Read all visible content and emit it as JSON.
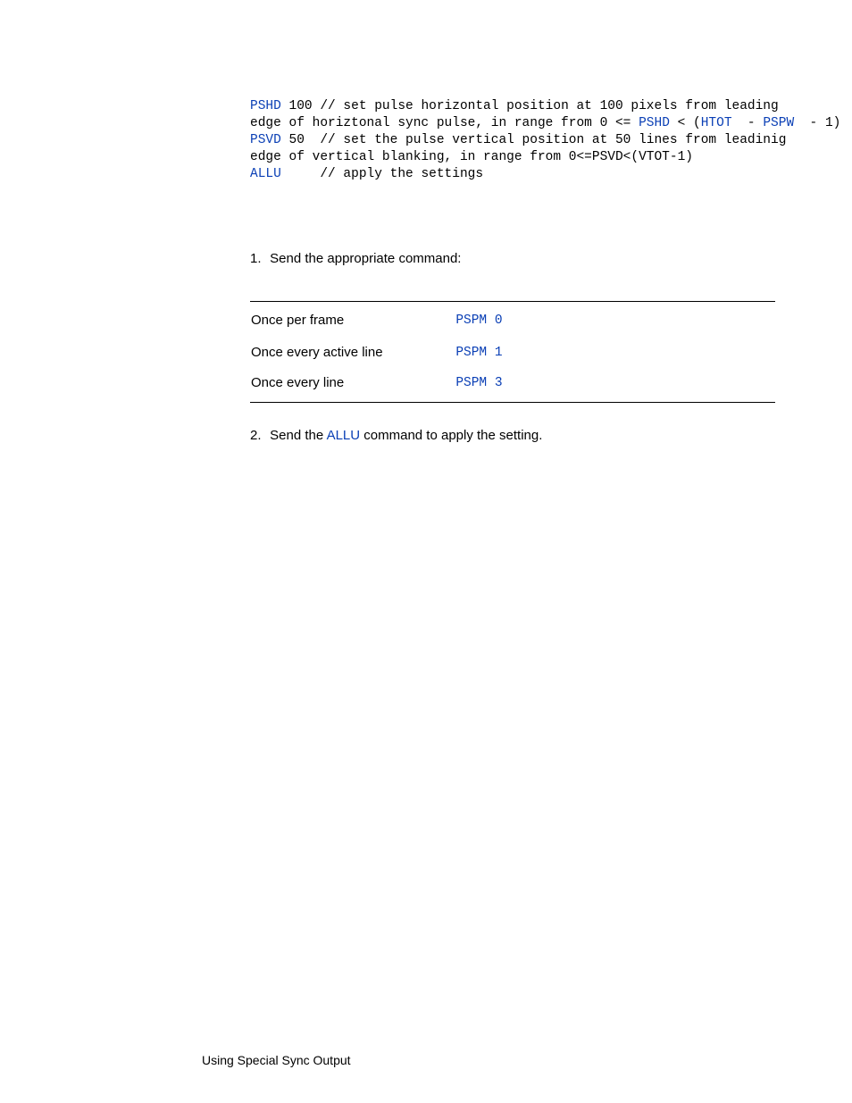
{
  "code": {
    "l1_kw": "PSHD",
    "l1_rest": " 100 // set pulse horizontal position at 100 pixels from leading",
    "l2_a": "edge of horiztonal sync pulse, in range from ",
    "l2_b": "0 <= ",
    "l2_c": "PSHD",
    "l2_d": " < (",
    "l2_e": "HTOT",
    "l2_f": "  - ",
    "l2_g": "PSPW",
    "l2_h": "  - 1)",
    "l3_kw": "PSVD",
    "l3_rest": " 50  // set the pulse vertical position at 50 lines from leadinig",
    "l4": "edge of vertical blanking, in range from 0<=PSVD<(VTOT-1)",
    "l5_kw": "ALLU",
    "l5_rest": "     // apply the settings"
  },
  "steps": {
    "s1_num": "1.",
    "s1_text": "Send the appropriate command:",
    "s2_num": "2.",
    "s2_a": "Send the ",
    "s2_link": "ALLU",
    "s2_b": "  command to apply the setting."
  },
  "table": {
    "r1_label": "Once per frame",
    "r1_cmd": "PSPM 0",
    "r2_label": "Once every active line",
    "r2_cmd": "PSPM 1",
    "r3_label": "Once every line",
    "r3_cmd": "PSPM 3"
  },
  "footer": "Using Special Sync Output"
}
